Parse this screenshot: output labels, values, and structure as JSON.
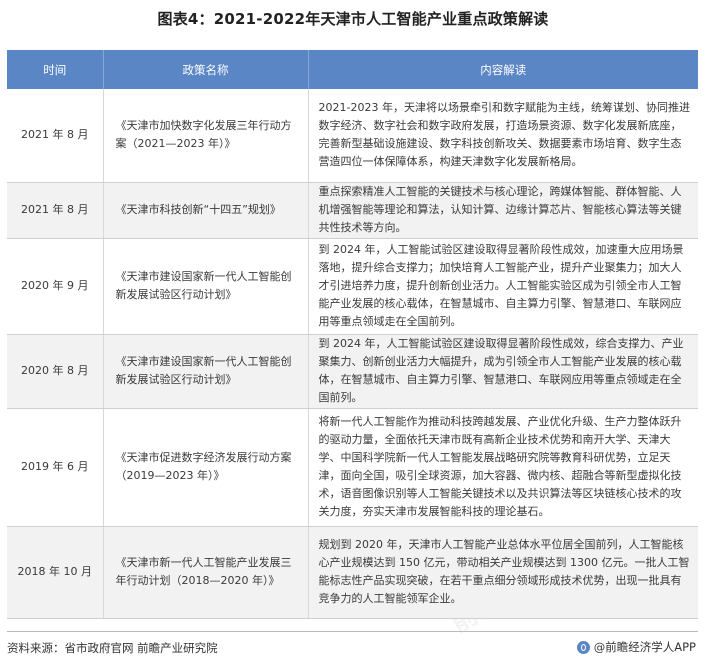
{
  "title": "图表4：2021-2022年天津市人工智能产业重点政策解读",
  "table": {
    "headers": [
      "时间",
      "政策名称",
      "内容解读"
    ],
    "rows": [
      {
        "time": "2021 年 8 月",
        "name": "《天津市加快数字化发展三年行动方案（2021—2023 年）》",
        "content": "2021-2023 年，天津将以场景牵引和数字赋能为主线，统筹谋划、协同推进数字经济、数字社会和数字政府发展，打造场景资源、数字化发展新底座，完善新型基础设施建设、数字科技创新攻关、数据要素市场培育、数字生态营造四位一体保障体系，构建天津数字化发展新格局。"
      },
      {
        "time": "2021 年 8 月",
        "name": "《天津市科技创新“十四五”规划》",
        "content": "重点探索精准人工智能的关键技术与核心理论，跨媒体智能、群体智能、人机增强智能等理论和算法，认知计算、边缘计算芯片、智能核心算法等关键共性技术等方向。"
      },
      {
        "time": "2020 年 9 月",
        "name": "《天津市建设国家新一代人工智能创新发展试验区行动计划》",
        "content": "到 2024 年，人工智能试验区建设取得显著阶段性成效，加速重大应用场景落地，提升综合支撑力；加快培育人工智能产业，提升产业聚集力；加大人才引进培养力度，提升创新创业活力。人工智能实验区成为引领全市人工智能产业发展的核心载体，在智慧城市、自主算力引擎、智慧港口、车联网应用等重点领域走在全国前列。"
      },
      {
        "time": "2020 年 8 月",
        "name": "《天津市建设国家新一代人工智能创新发展试验区行动计划》",
        "content": "到 2024 年，人工智能试验区建设取得显著阶段性成效，综合支撑力、产业聚集力、创新创业活力大幅提升，成为引领全市人工智能产业发展的核心载体，在智慧城市、自主算力引擎、智慧港口、车联网应用等重点领域走在全国前列。"
      },
      {
        "time": "2019 年 6 月",
        "name": "《天津市促进数字经济发展行动方案（2019—2023 年）》",
        "content": "将新一代人工智能作为推动科技跨越发展、产业优化升级、生产力整体跃升的驱动力量，全面依托天津市既有高新企业技术优势和南开大学、天津大学、中国科学院新一代人工智能发展战略研究院等教育科研优势，立足天津，面向全国，吸引全球资源，加大容器、微内核、超融合等新型虚拟化技术，语音图像识别等人工智能关键技术以及共识算法等区块链核心技术的攻关力度，夯实天津市发展智能科技的理论基石。"
      },
      {
        "time": "2018 年 10 月",
        "name": "《天津市新一代人工智能产业发展三年行动计划（2018—2020 年）》",
        "content": "规划到 2020 年，天津市人工智能产业总体水平位居全国前列，人工智能核心产业规模达到 150 亿元，带动相关产业规模达到 1300 亿元。一批人工智能标志性产品实现突破，在若干重点细分领域形成技术优势，出现一批具有竞争力的人工智能领军企业。"
      }
    ]
  },
  "footer": {
    "source": "资料来源：省市政府官网 前瞻产业研究院",
    "brand": "@前瞻经济学人APP"
  },
  "colors": {
    "header_bg": "#5b86c6",
    "stripe": "#f2f2f2"
  }
}
